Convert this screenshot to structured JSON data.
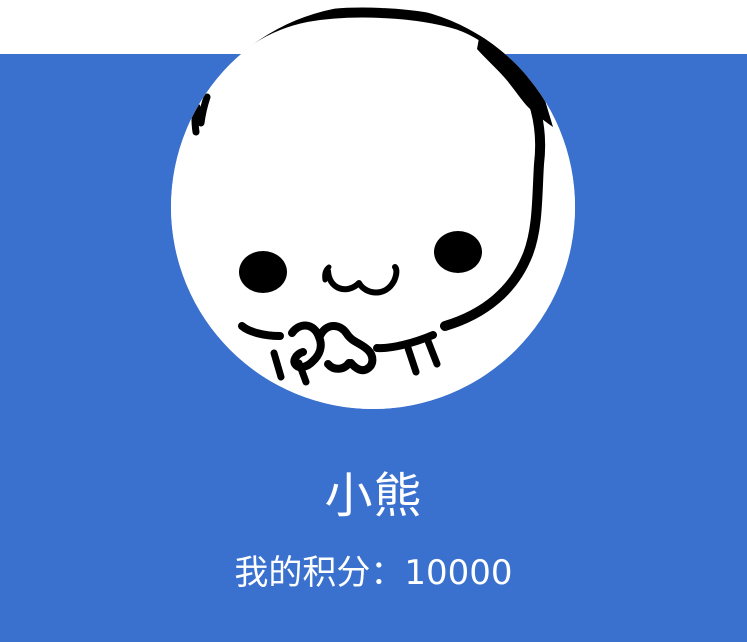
{
  "profile": {
    "name": "小熊",
    "points_label": "我的积分：",
    "points_value": "10000",
    "avatar_icon": "panda-avatar-icon"
  },
  "colors": {
    "background_top": "#ffffff",
    "profile_background": "#3a71cf",
    "text": "#ffffff",
    "avatar_outline": "#000000"
  }
}
